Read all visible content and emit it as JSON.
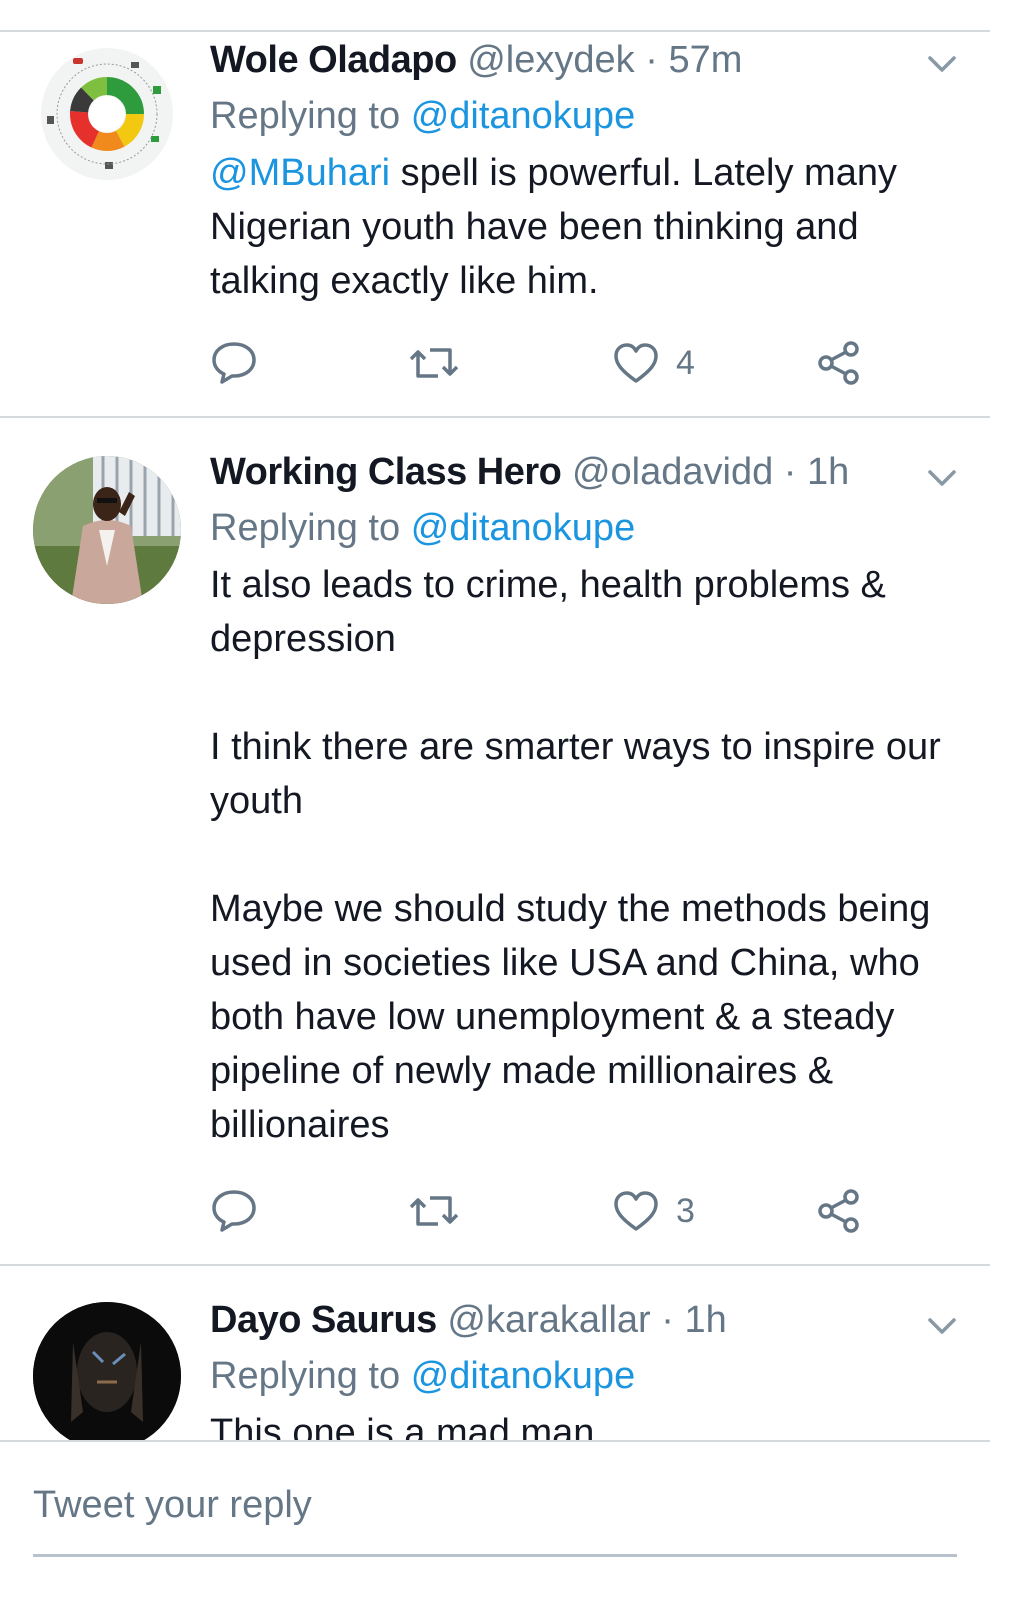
{
  "tweets": [
    {
      "name": "Wole Oladapo",
      "handle": "@lexydek",
      "separator": "·",
      "time": "57m",
      "reply_prefix": "Replying to",
      "reply_to": "@ditanokupe",
      "mention": "@MBuhari",
      "text": " spell is powerful. Lately many Nigerian youth have been thinking and talking exactly like him.",
      "likes": "4"
    },
    {
      "name": "Working Class Hero",
      "handle": "@oladavidd",
      "separator": "·",
      "time": "1h",
      "reply_prefix": "Replying to",
      "reply_to": "@ditanokupe",
      "paragraphs": [
        "It also leads to crime, health problems & depression",
        "I think there are smarter ways to inspire our youth",
        "Maybe we should study the methods being used in societies like USA and China, who both have low unemployment & a steady pipeline of newly made millionaires & billionaires"
      ],
      "likes": "3"
    },
    {
      "name": "Dayo Saurus",
      "handle": "@karakallar",
      "separator": "·",
      "time": "1h",
      "reply_prefix": "Replying to",
      "reply_to": "@ditanokupe",
      "text": "This one is a mad man"
    }
  ],
  "composer": {
    "placeholder": "Tweet your reply"
  },
  "colors": {
    "link": "#1b95e0",
    "secondary_text": "#657786",
    "primary_text": "#141823",
    "divider": "#d6d9db"
  },
  "icons": [
    "reply-icon",
    "retweet-icon",
    "like-icon",
    "share-icon",
    "chevron-down-icon"
  ]
}
